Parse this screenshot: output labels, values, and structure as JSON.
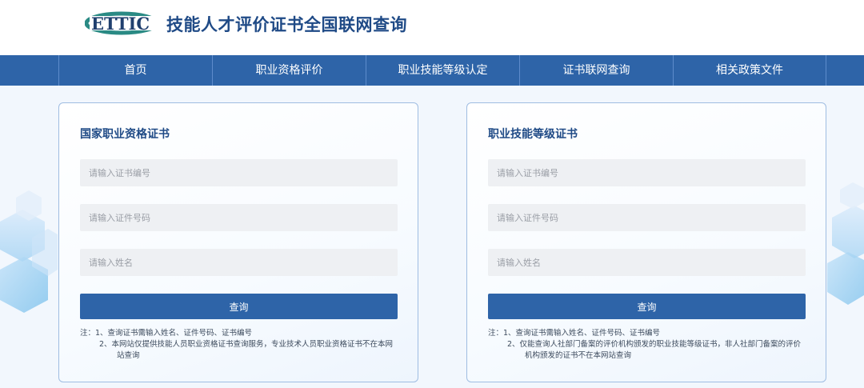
{
  "header": {
    "logo_text": "ETTIC",
    "title": "技能人才评价证书全国联网查询"
  },
  "nav": {
    "items": [
      "首页",
      "职业资格评价",
      "职业技能等级认定",
      "证书联网查询",
      "相关政策文件"
    ]
  },
  "cards": [
    {
      "title": "国家职业资格证书",
      "cert_no_placeholder": "请输入证书编号",
      "id_no_placeholder": "请输入证件号码",
      "name_placeholder": "请输入姓名",
      "button": "查询",
      "note_prefix": "注：",
      "note_1": "1、查询证书需输入姓名、证件号码、证书编号",
      "note_2a": "2、本网站仅提供技能人员职业资格证书查询服务，专业技术人员职业资格证书不在本网",
      "note_2b": "站查询"
    },
    {
      "title": "职业技能等级证书",
      "cert_no_placeholder": "请输入证书编号",
      "id_no_placeholder": "请输入证件号码",
      "name_placeholder": "请输入姓名",
      "button": "查询",
      "note_prefix": "注：",
      "note_1": "1、查询证书需输入姓名、证件号码、证书编号",
      "note_2a": "2、仅能查询人社部门备案的评价机构颁发的职业技能等级证书，非人社部门备案的评价",
      "note_2b": "机构颁发的证书不在本网站查询"
    }
  ],
  "colors": {
    "brand_blue": "#2e64a8",
    "title_blue": "#1f4a86",
    "logo_teal": "#2a8a84"
  }
}
